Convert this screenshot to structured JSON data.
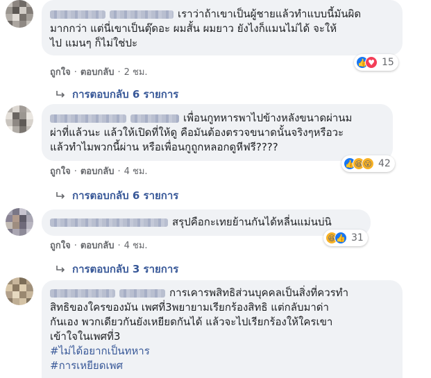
{
  "comments": [
    {
      "text": "เราว่าถ้าเขาเป็นผู้ชายแล้วทำแบบนี้มันผิดมากกว่า แต่นี่เขาเป็นตุ๊ดอะ ผมสั้น ผมยาว ยังไงก็แมนไม่ได้ จะให้ไป แมนๆ ก็ไม่ใช่ปะ",
      "lines": [
        "เราว่าถ้าเขาเป็นผู้ชายแล้วทำแบบนี้มันผิด",
        "มากกว่า แต่นี่เขาเป็นตุ๊ดอะ ผมสั้น ผมยาว ยังไงก็แมนไม่ได้ จะให้",
        "ไป แมนๆ ก็ไม่ใช่ปะ"
      ],
      "like_label": "ถูกใจ",
      "reply_label": "ตอบกลับ",
      "time": "2 ชม.",
      "reaction_icons": [
        "like-icon",
        "love-icon"
      ],
      "reaction_count": "15",
      "replies_label": "การตอบกลับ 6 รายการ"
    },
    {
      "lines": [
        "เพื่อนกูทหารพาไปข้างหลังขนาดผ่านม",
        "ผ่าที่แล้วนะ แล้วให้เปิดที่ให้ดู คือมันต้องตรวจขนาดนั้นจริงๆหรือวะ",
        "แล้วทำไมพวกนี้ผ่าน หรือเพื่อนกูถูกหลอกดูหีฟรี????"
      ],
      "like_label": "ถูกใจ",
      "reply_label": "ตอบกลับ",
      "time": "4 ชม.",
      "reaction_icons": [
        "like-icon",
        "haha-icon",
        "wow-icon"
      ],
      "reaction_count": "42",
      "replies_label": "การตอบกลับ 6 รายการ"
    },
    {
      "lines": [
        "สรุปคือกะเทยย้านกันได้หลี่นแม่นบ่นิ"
      ],
      "like_label": "ถูกใจ",
      "reply_label": "ตอบกลับ",
      "time": "4 ชม.",
      "reaction_icons": [
        "haha-icon",
        "like-icon"
      ],
      "reaction_count": "31",
      "replies_label": "การตอบกลับ 3 รายการ"
    },
    {
      "lines": [
        "การเคารพสิทธิส่วนบุคคลเป็นสิ่งที่ควรทำ",
        "สิทธิของใครของมัน เพศที่3พยายามเรียกร้องสิทธิ แต่กลับมาด่า",
        "กันเอง พวกเดียวกันยังเหยียดกันได้ แล้วจะไปเรียกร้องให้ใครเขา",
        "เข้าใจในเพศที่3"
      ],
      "hashtags": [
        "#ไม่ได้อยากเป็นทหาร",
        "#การเหยียดเพศ"
      ]
    }
  ]
}
